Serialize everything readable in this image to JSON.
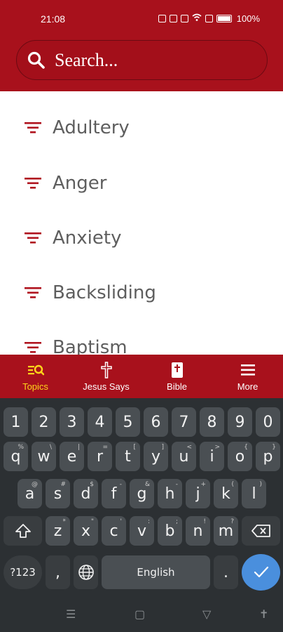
{
  "status_bar": {
    "time": "21:08",
    "battery_text": "100%"
  },
  "search": {
    "placeholder": "Search..."
  },
  "topics": [
    {
      "label": "Adultery",
      "icon": "filter-icon"
    },
    {
      "label": "Anger",
      "icon": "filter-icon"
    },
    {
      "label": "Anxiety",
      "icon": "filter-icon"
    },
    {
      "label": "Backsliding",
      "icon": "filter-icon"
    },
    {
      "label": "Baptism",
      "icon": "filter-icon"
    }
  ],
  "bottom_nav": {
    "items": [
      {
        "label": "Topics",
        "icon": "topics-search-icon",
        "active": true
      },
      {
        "label": "Jesus Says",
        "icon": "cross-icon",
        "active": false
      },
      {
        "label": "Bible",
        "icon": "bible-icon",
        "active": false
      },
      {
        "label": "More",
        "icon": "menu-icon",
        "active": false
      }
    ]
  },
  "keyboard": {
    "number_row": [
      "1",
      "2",
      "3",
      "4",
      "5",
      "6",
      "7",
      "8",
      "9",
      "0"
    ],
    "row1": [
      {
        "key": "q",
        "hint": "%"
      },
      {
        "key": "w",
        "hint": "\\"
      },
      {
        "key": "e",
        "hint": "|"
      },
      {
        "key": "r",
        "hint": "="
      },
      {
        "key": "t",
        "hint": "["
      },
      {
        "key": "y",
        "hint": "]"
      },
      {
        "key": "u",
        "hint": "<"
      },
      {
        "key": "i",
        "hint": ">"
      },
      {
        "key": "o",
        "hint": "{"
      },
      {
        "key": "p",
        "hint": "}"
      }
    ],
    "row2": [
      {
        "key": "a",
        "hint": "@"
      },
      {
        "key": "s",
        "hint": "#"
      },
      {
        "key": "d",
        "hint": "$"
      },
      {
        "key": "f",
        "hint": "-"
      },
      {
        "key": "g",
        "hint": "&"
      },
      {
        "key": "h",
        "hint": "-"
      },
      {
        "key": "j",
        "hint": "+"
      },
      {
        "key": "k",
        "hint": "("
      },
      {
        "key": "l",
        "hint": ")"
      }
    ],
    "row3": [
      {
        "key": "z",
        "hint": "*"
      },
      {
        "key": "x",
        "hint": "\""
      },
      {
        "key": "c",
        "hint": "'"
      },
      {
        "key": "v",
        "hint": ":"
      },
      {
        "key": "b",
        "hint": ";"
      },
      {
        "key": "n",
        "hint": "!"
      },
      {
        "key": "m",
        "hint": "?"
      }
    ],
    "symbols_label": "?123",
    "comma": ",",
    "space_label": "English",
    "period": "."
  },
  "colors": {
    "brand": "#a8111c",
    "active_nav": "#ffd51a",
    "enter_key": "#4a8fdd"
  }
}
